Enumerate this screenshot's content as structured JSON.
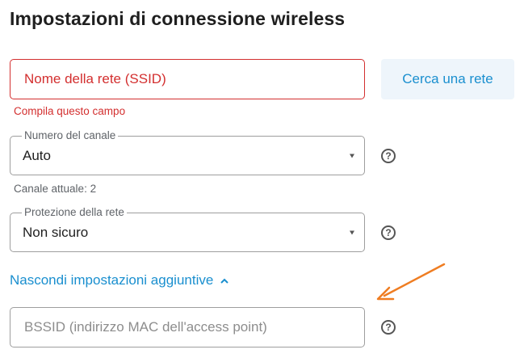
{
  "page": {
    "title": "Impostazioni di connessione wireless"
  },
  "ssid": {
    "placeholder": "Nome della rete (SSID)",
    "error": "Compila questo campo"
  },
  "scan_button": {
    "label": "Cerca una rete"
  },
  "channel": {
    "label": "Numero del canale",
    "value": "Auto",
    "helper": "Canale attuale: 2"
  },
  "security": {
    "label": "Protezione della rete",
    "value": "Non sicuro"
  },
  "advanced": {
    "toggle_label": "Nascondi impostazioni aggiuntive",
    "toggle_icon": "chevron-up-icon"
  },
  "bssid": {
    "placeholder": "BSSID (indirizzo MAC dell'access point)"
  },
  "help_icon": {
    "glyph": "?"
  },
  "colors": {
    "accent": "#1a8fcf",
    "error": "#d32f2f",
    "annotation_arrow": "#ef7d22",
    "button_bg": "#eef5fb"
  }
}
